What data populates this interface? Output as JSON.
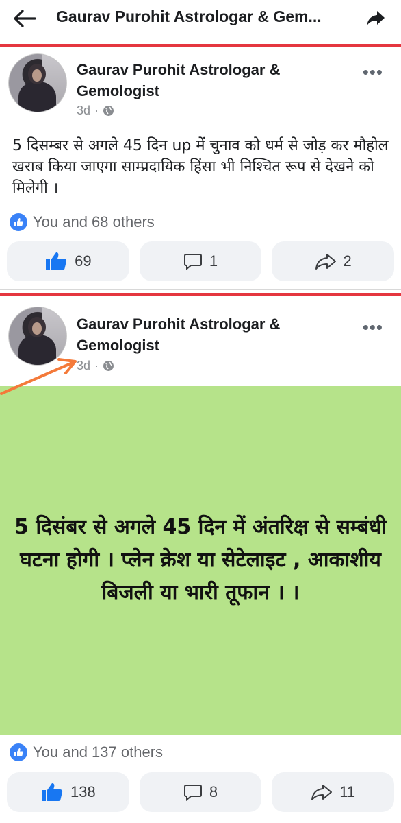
{
  "header": {
    "title": "Gaurav Purohit Astrologar & Gem...",
    "back_icon": "back-arrow-icon",
    "share_icon": "share-forward-icon"
  },
  "posts": [
    {
      "author": "Gaurav Purohit Astrologar & Gemologist",
      "time": "3d",
      "separator": "·",
      "privacy_icon": "globe-icon",
      "text": "5 दिसम्बर से अगले 45 दिन up में चुनाव को धर्म से जोड़ कर मौहोल खराब किया जाएगा साम्प्रदायिक हिंसा भी निश्चित रूप से देखने को मिलेगी ।",
      "reactions": "You and 68 others",
      "likes": "69",
      "comments": "1",
      "shares": "2"
    },
    {
      "author": "Gaurav Purohit Astrologar & Gemologist",
      "time": "3d",
      "separator": "·",
      "privacy_icon": "globe-icon",
      "image_text": "5 दिसंबर से अगले 45 दिन में अंतरिक्ष से सम्बंधी घटना होगी । प्लेन क्रेश या सेटेलाइट , आकाशीय बिजली या भारी तूफान । ।",
      "reactions": "You and 137 others",
      "likes": "138",
      "comments": "8",
      "shares": "11"
    }
  ],
  "colors": {
    "accent_red": "#e5363f",
    "like_blue": "#3a82f7",
    "image_background": "#b6e38a",
    "annotation_arrow": "#f47a3a"
  }
}
